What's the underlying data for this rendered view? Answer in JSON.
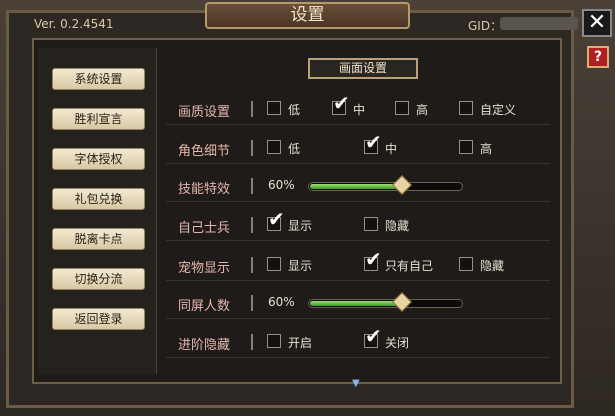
{
  "window": {
    "title": "设置",
    "version": "Ver. 0.2.4541",
    "gid_label": "GID：",
    "close_glyph": "✕",
    "help_glyph": "?"
  },
  "sidebar": {
    "items": [
      {
        "label": "系统设置"
      },
      {
        "label": "胜利宣言"
      },
      {
        "label": "字体授权"
      },
      {
        "label": "礼包兑换"
      },
      {
        "label": "脱离卡点"
      },
      {
        "label": "切换分流"
      },
      {
        "label": "返回登录"
      }
    ]
  },
  "section": {
    "title": "画面设置"
  },
  "settings": {
    "quality": {
      "label": "画质设置",
      "options": [
        {
          "label": "低",
          "checked": false
        },
        {
          "label": "中",
          "checked": true
        },
        {
          "label": "高",
          "checked": false
        },
        {
          "label": "自定义",
          "checked": false
        }
      ]
    },
    "detail": {
      "label": "角色细节",
      "options": [
        {
          "label": "低",
          "checked": false
        },
        {
          "label": "中",
          "checked": true
        },
        {
          "label": "高",
          "checked": false
        }
      ]
    },
    "effects": {
      "label": "技能特效",
      "value_text": "60%",
      "value": 0.6
    },
    "soldiers": {
      "label": "自己士兵",
      "options": [
        {
          "label": "显示",
          "checked": true
        },
        {
          "label": "隐藏",
          "checked": false
        }
      ]
    },
    "pets": {
      "label": "宠物显示",
      "options": [
        {
          "label": "显示",
          "checked": false
        },
        {
          "label": "只有自己",
          "checked": true
        },
        {
          "label": "隐藏",
          "checked": false
        }
      ]
    },
    "same_screen": {
      "label": "同屏人数",
      "value_text": "60%",
      "value": 0.6
    },
    "advance_hide": {
      "label": "进阶隐藏",
      "options": [
        {
          "label": "开启",
          "checked": false
        },
        {
          "label": "关闭",
          "checked": true
        }
      ]
    }
  },
  "colors": {
    "label_pink": "#e6b6ae",
    "slider_green": "#5cc040"
  }
}
